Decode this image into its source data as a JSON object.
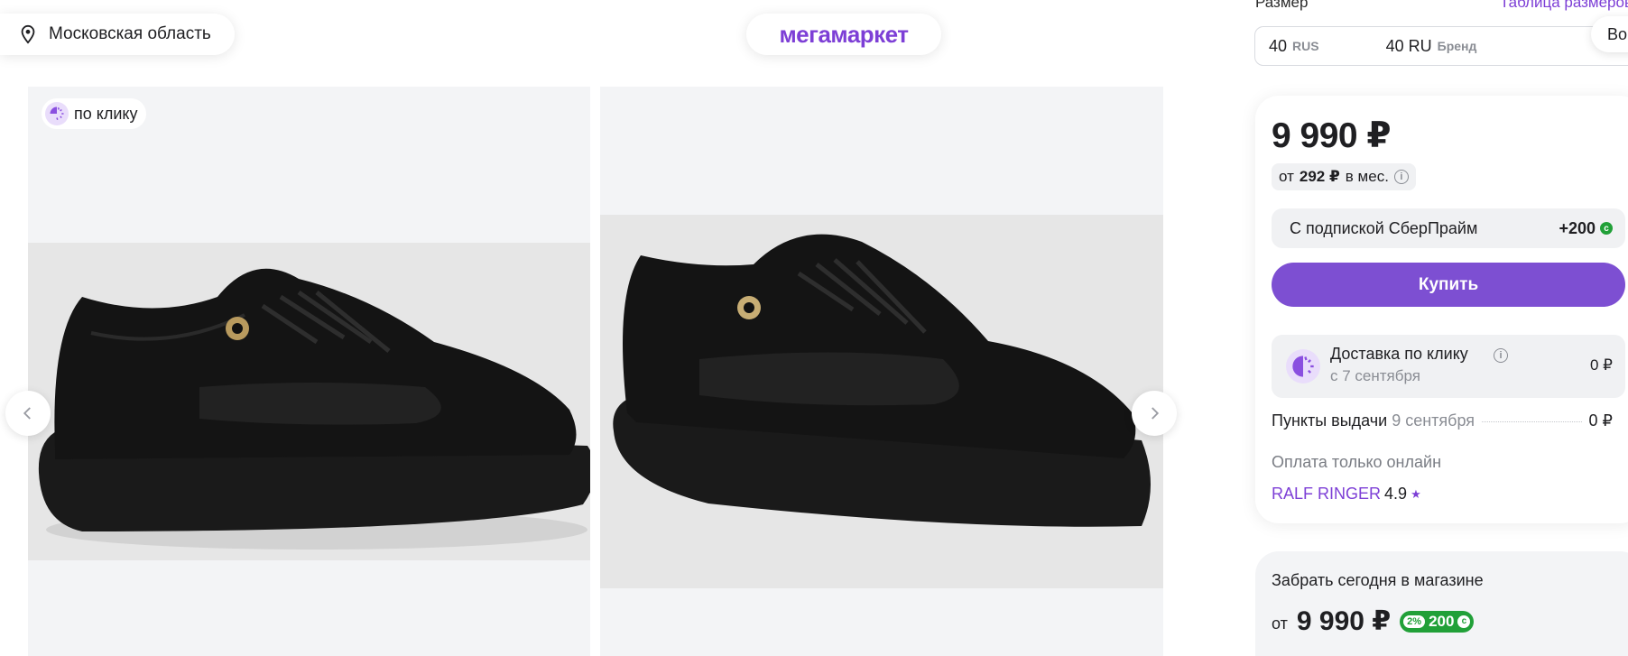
{
  "header": {
    "location": "Московская область",
    "logo": "мегамаркет"
  },
  "gallery": {
    "badge": "по клику",
    "images": [
      {
        "alt": "black-sneaker-side-view"
      },
      {
        "alt": "black-sneaker-angle-view"
      }
    ]
  },
  "size": {
    "label": "Размер",
    "table_link": "Таблица размеров",
    "value_rus": "40",
    "unit_rus": "RUS",
    "value_brand": "40 RU",
    "unit_brand": "Бренд",
    "side_pill": "Во"
  },
  "buy": {
    "price": "9 990 ₽",
    "installment_prefix": "от",
    "installment_amount": "292 ₽",
    "installment_suffix": "в мес.",
    "sber_label": "С подпиской СберПрайм",
    "sber_bonus": "+200",
    "buy_button": "Купить",
    "delivery_title": "Доставка по клику",
    "delivery_date": "с 7 сентября",
    "delivery_price": "0 ₽",
    "pickup_label": "Пункты выдачи",
    "pickup_date": "9 сентября",
    "pickup_price": "0 ₽",
    "online_only": "Оплата только онлайн",
    "seller_name": "RALF RINGER",
    "seller_rating": "4.9"
  },
  "store": {
    "title": "Забрать сегодня в магазине",
    "from": "от",
    "price": "9 990 ₽",
    "bonus_percent": "2%",
    "bonus_amount": "200"
  },
  "colors": {
    "accent": "#7d3fd6",
    "button": "#7d4fd2",
    "sber_green": "#21a038"
  }
}
